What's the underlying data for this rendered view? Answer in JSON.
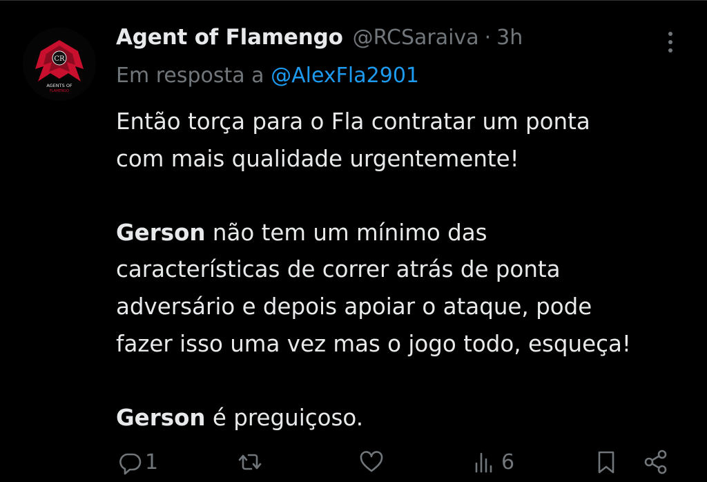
{
  "tweet": {
    "author": {
      "display_name": "Agent of Flamengo",
      "handle": "@RCSaraiva",
      "avatar_text": "AGENTS OF",
      "avatar_subtext": "FLAMENGO"
    },
    "separator": "·",
    "time_ago": "3h",
    "reply_prefix": "Em resposta a",
    "reply_to": "@AlexFla2901",
    "paragraph1_line1": "Então torça para o Fla contratar um ponta",
    "paragraph1_line2": "com mais qualidade urgentemente!",
    "paragraph2_bold": "Gerson",
    "paragraph2_line1_rest": " não tem um mínimo das",
    "paragraph2_line2": "características de correr atrás de ponta",
    "paragraph2_line3": "adversário e depois apoiar o ataque, pode",
    "paragraph2_line4": "fazer isso uma vez mas o jogo todo, esqueça!",
    "paragraph3_bold": "Gerson",
    "paragraph3_rest": " é preguiçoso.",
    "actions": {
      "reply_count": "1",
      "retweet_count": "",
      "like_count": "",
      "views_count": "6"
    },
    "icons": [
      "more-icon",
      "reply-icon",
      "retweet-icon",
      "like-icon",
      "views-icon",
      "bookmark-icon",
      "share-icon"
    ],
    "colors": {
      "background": "#000000",
      "text": "#e7e9ea",
      "secondary": "#71767b",
      "link": "#1d9bf0",
      "avatar_red": "#c8102e"
    }
  }
}
